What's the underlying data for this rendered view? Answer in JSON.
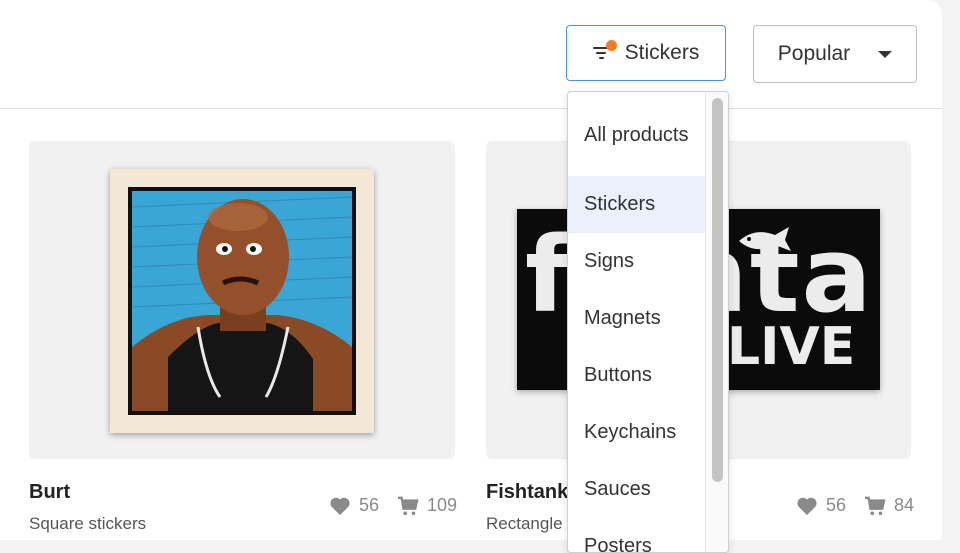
{
  "toolbar": {
    "filter_label": "Stickers",
    "filter_icon": "filter-icon",
    "filter_badge_color": "#f47c20",
    "sort_label": "Popular"
  },
  "dropdown": {
    "items": [
      "All products",
      "Stickers",
      "Signs",
      "Magnets",
      "Buttons",
      "Keychains",
      "Sauces",
      "Posters"
    ],
    "selected": "Stickers",
    "accent_color": "#4a90d9"
  },
  "products": [
    {
      "title": "Burt",
      "subtitle": "Square stickers",
      "likes": "56",
      "cart": "109"
    },
    {
      "title": "Fishtank Live",
      "subtitle": "Rectangle stickers",
      "likes": "56",
      "cart": "84"
    }
  ],
  "artwork": {
    "fish_word": "fishtank",
    "fish_sub": "LIVE"
  }
}
